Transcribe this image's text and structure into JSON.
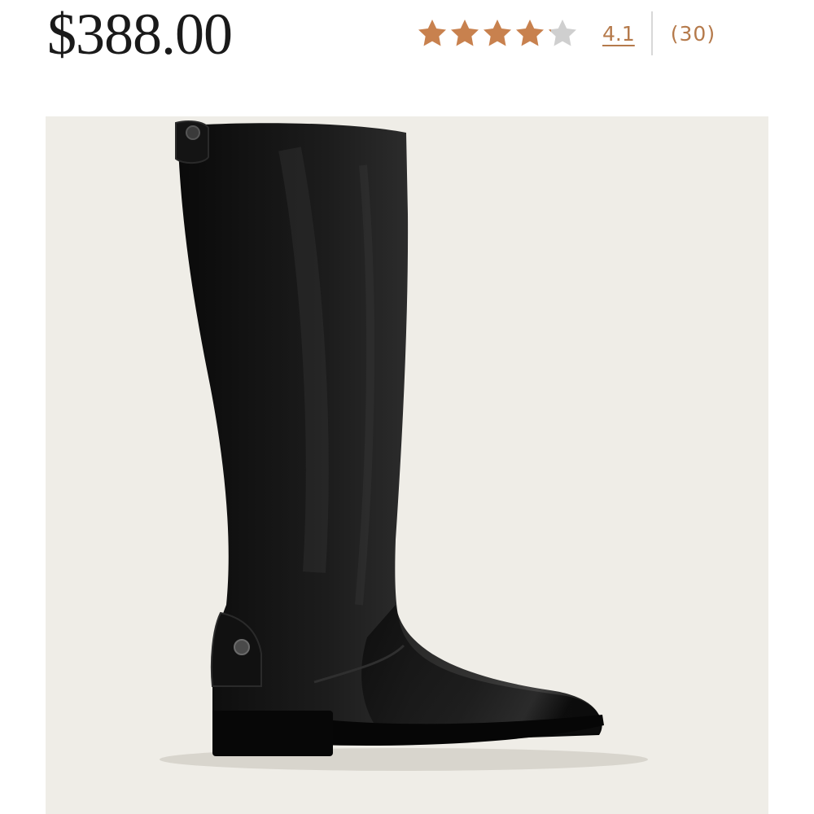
{
  "product": {
    "price": "$388.00",
    "rating": {
      "value": 4.1,
      "value_label": "4.1",
      "review_count_label": "(30)",
      "max": 5,
      "star_color": "#c8814e",
      "empty_star_color": "#cfcfcf"
    },
    "image": {
      "subject": "black leather knee-high riding boot",
      "background_color": "#efede7"
    }
  }
}
